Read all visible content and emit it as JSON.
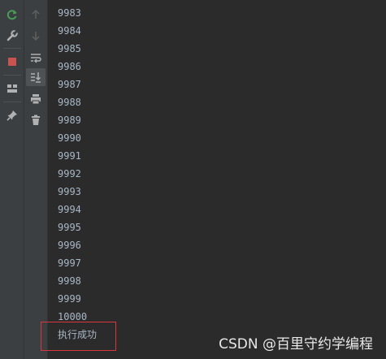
{
  "toolbar_left": {
    "rerun": {
      "icon": "rerun-icon",
      "color": "#499c54"
    },
    "settings": {
      "icon": "wrench-icon"
    },
    "stop": {
      "icon": "stop-icon",
      "color": "#c75450"
    },
    "layout": {
      "icon": "layout-icon"
    },
    "pin": {
      "icon": "pin-icon"
    }
  },
  "toolbar_right": {
    "up": {
      "icon": "arrow-up-icon"
    },
    "down": {
      "icon": "arrow-down-icon"
    },
    "wrap": {
      "icon": "soft-wrap-icon"
    },
    "scroll_end": {
      "icon": "scroll-to-end-icon"
    },
    "print": {
      "icon": "print-icon"
    },
    "clear": {
      "icon": "trash-icon"
    }
  },
  "console": {
    "lines": [
      "9983",
      "9984",
      "9985",
      "9986",
      "9987",
      "9988",
      "9989",
      "9990",
      "9991",
      "9992",
      "9993",
      "9994",
      "9995",
      "9996",
      "9997",
      "9998",
      "9999",
      "10000"
    ],
    "success_message": "执行成功",
    "text_color": "#a9b7c6",
    "highlight_color": "#d9363e"
  },
  "watermark": "CSDN @百里守约学编程"
}
